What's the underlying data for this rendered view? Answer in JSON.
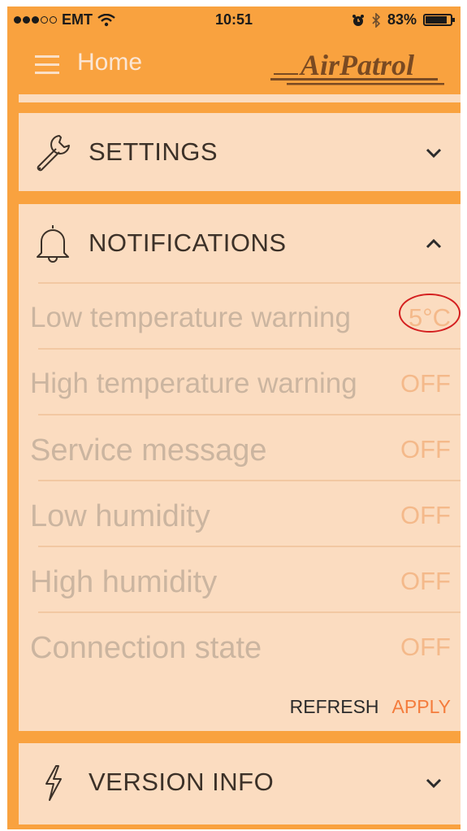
{
  "status_bar": {
    "carrier": "EMT",
    "time": "10:51",
    "battery": "83%",
    "battery_level": 0.83,
    "icons": [
      "signal-dots-icon",
      "wifi-icon",
      "alarm-icon",
      "bluetooth-icon",
      "battery-icon"
    ]
  },
  "nav": {
    "title": "Home",
    "logo_text": "AirPatrol"
  },
  "sections": {
    "settings": {
      "title": "SETTINGS",
      "icon": "wrench-icon",
      "expanded": false
    },
    "notifications": {
      "title": "NOTIFICATIONS",
      "icon": "bell-icon",
      "expanded": true,
      "rows": [
        {
          "label": "Low temperature warning",
          "value": "5°C"
        },
        {
          "label": "High temperature warning",
          "value": "OFF"
        },
        {
          "label": "Service message",
          "value": "OFF"
        },
        {
          "label": "Low humidity",
          "value": "OFF"
        },
        {
          "label": "High humidity",
          "value": "OFF"
        },
        {
          "label": "Connection state",
          "value": "OFF"
        }
      ],
      "refresh_label": "REFRESH",
      "apply_label": "APPLY"
    },
    "version_info": {
      "title": "VERSION INFO",
      "icon": "lightning-icon",
      "expanded": false
    }
  },
  "colors": {
    "background": "#f9a23f",
    "panel": "#fbdcc0",
    "apply": "#f47c3c",
    "highlight_circle": "#d42020"
  }
}
